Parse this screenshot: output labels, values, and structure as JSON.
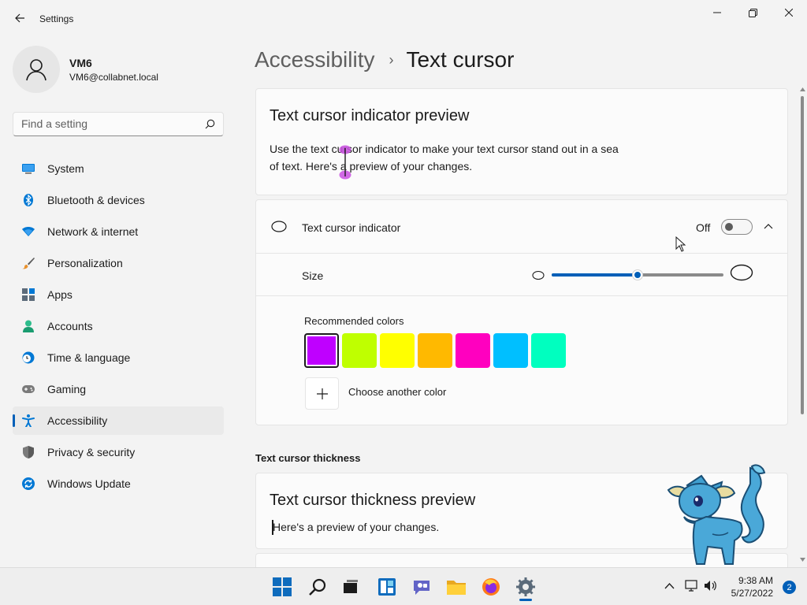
{
  "window": {
    "title": "Settings"
  },
  "profile": {
    "name": "VM6",
    "email": "VM6@collabnet.local"
  },
  "search": {
    "placeholder": "Find a setting"
  },
  "sidebar": {
    "items": [
      {
        "label": "System",
        "icon": "system-icon",
        "color": "#0078d4"
      },
      {
        "label": "Bluetooth & devices",
        "icon": "bluetooth-icon",
        "color": "#0078d4"
      },
      {
        "label": "Network & internet",
        "icon": "wifi-icon",
        "color": "#0078d4"
      },
      {
        "label": "Personalization",
        "icon": "brush-icon",
        "color": "#e8912d"
      },
      {
        "label": "Apps",
        "icon": "apps-icon",
        "color": "#5c6b7a"
      },
      {
        "label": "Accounts",
        "icon": "person-icon",
        "color": "#2dbd8c"
      },
      {
        "label": "Time & language",
        "icon": "globe-clock-icon",
        "color": "#0078d4"
      },
      {
        "label": "Gaming",
        "icon": "gamepad-icon",
        "color": "#7a7a7a"
      },
      {
        "label": "Accessibility",
        "icon": "accessibility-icon",
        "color": "#0078d4"
      },
      {
        "label": "Privacy & security",
        "icon": "shield-icon",
        "color": "#7a7a7a"
      },
      {
        "label": "Windows Update",
        "icon": "update-icon",
        "color": "#0078d4"
      }
    ],
    "active_index": 8
  },
  "breadcrumb": {
    "parent": "Accessibility",
    "separator": "›",
    "current": "Text cursor"
  },
  "preview_card": {
    "title": "Text cursor indicator preview",
    "line1": "Use the text cursor indicator to make your text cursor stand out in a sea",
    "line2": "of text. Here's a preview of your changes."
  },
  "indicator": {
    "label": "Text cursor indicator",
    "state_label": "Off",
    "enabled": false
  },
  "size": {
    "label": "Size",
    "value_fraction": 0.5
  },
  "colors": {
    "label": "Recommended colors",
    "swatches": [
      "#bf00ff",
      "#bfff00",
      "#ffff00",
      "#ffb900",
      "#ff00bf",
      "#00bfff",
      "#00ffbf"
    ],
    "selected_index": 0,
    "choose_label": "Choose another color"
  },
  "thickness": {
    "section_label": "Text cursor thickness",
    "title": "Text cursor thickness preview",
    "text": "Here's a preview of your changes."
  },
  "taskbar": {
    "time": "9:38 AM",
    "date": "5/27/2022",
    "notifications": "2"
  },
  "theme": {
    "accent": "#005fb8"
  }
}
